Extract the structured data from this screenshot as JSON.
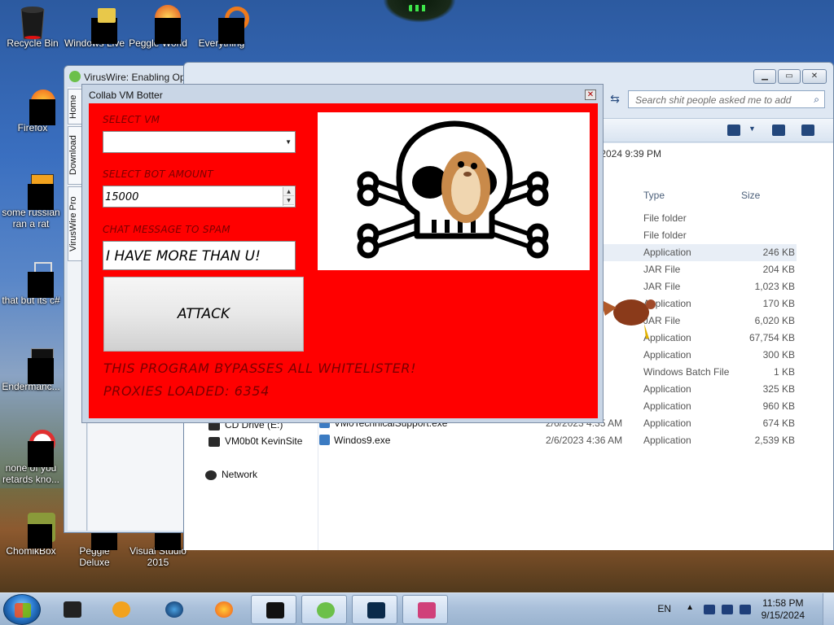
{
  "desktop": {
    "icons": [
      {
        "label": "Recycle Bin"
      },
      {
        "label": "Windows Live"
      },
      {
        "label": "Peggle World"
      },
      {
        "label": "Everything"
      },
      {
        "label": "Firefox"
      },
      {
        "label": "some russian ran a rat"
      },
      {
        "label": "that but its c#"
      },
      {
        "label": "Endermanc..."
      },
      {
        "label": "none of you retards kno..."
      },
      {
        "label": "ChomikBox"
      },
      {
        "label": "Peggle Deluxe"
      },
      {
        "label": "Visual Studio 2015"
      }
    ]
  },
  "explorer": {
    "search_placeholder": "Search shit people asked me to add",
    "header_date": "/2024 9:39 PM",
    "columns": {
      "type": "Type",
      "size": "Size"
    },
    "nav": [
      "CD Drive (E:)",
      "VM0b0t KevinSite",
      "Network"
    ],
    "rows": [
      {
        "name": "",
        "date": "AM",
        "type": "File folder",
        "size": ""
      },
      {
        "name": "",
        "date": "16 AM",
        "type": "File folder",
        "size": ""
      },
      {
        "name": "",
        "date": "AM",
        "type": "Application",
        "size": "246 KB"
      },
      {
        "name": "",
        "date": "4 AM",
        "type": "JAR File",
        "size": "204 KB"
      },
      {
        "name": "",
        "date": "5 AM",
        "type": "JAR File",
        "size": "1,023 KB"
      },
      {
        "name": "",
        "date": "AM",
        "type": "Application",
        "size": "170 KB"
      },
      {
        "name": "",
        "date": "3 AM",
        "type": "JAR File",
        "size": "6,020 KB"
      },
      {
        "name": "",
        "date": "AM",
        "type": "Application",
        "size": "67,754 KB"
      },
      {
        "name": "",
        "date": "AM",
        "type": "Application",
        "size": "300 KB"
      },
      {
        "name": "",
        "date": "9 AM",
        "type": "Windows Batch File",
        "size": "1 KB"
      },
      {
        "name": "",
        "date": "PM",
        "type": "Application",
        "size": "325 KB"
      },
      {
        "name": "",
        "date": "AM",
        "type": "Application",
        "size": "960 KB"
      },
      {
        "name": "VM0TechnicalSupport.exe",
        "date": "2/6/2023 4:35 AM",
        "type": "Application",
        "size": "674 KB"
      },
      {
        "name": "Windos9.exe",
        "date": "2/6/2023 4:36 AM",
        "type": "Application",
        "size": "2,539 KB"
      }
    ]
  },
  "viruswire": {
    "title": "VirusWire: Enabling Op",
    "tabs": [
      "Home",
      "Download",
      "VirusWire Pro"
    ]
  },
  "botter": {
    "title": "Collab VM Botter",
    "select_vm_label": "SELECT VM",
    "select_vm_value": "",
    "bot_amount_label": "SELECT BOT AMOUNT",
    "bot_amount_value": "15000",
    "chat_label": "CHAT MESSAGE TO SPAM",
    "chat_value": "I HAVE MORE THAN U!",
    "attack_label": "ATTACK",
    "footer_line1": "THIS PROGRAM BYPASSES ALL WHITELISTER!",
    "footer_line2": "PROXIES LOADED: 6354"
  },
  "taskbar": {
    "language": "EN",
    "time": "11:58 PM",
    "date": "9/15/2024"
  },
  "colors": {
    "panel_red": "#ff0000",
    "label_dark_red": "#7a0000",
    "taskbar": "#aac0da"
  }
}
